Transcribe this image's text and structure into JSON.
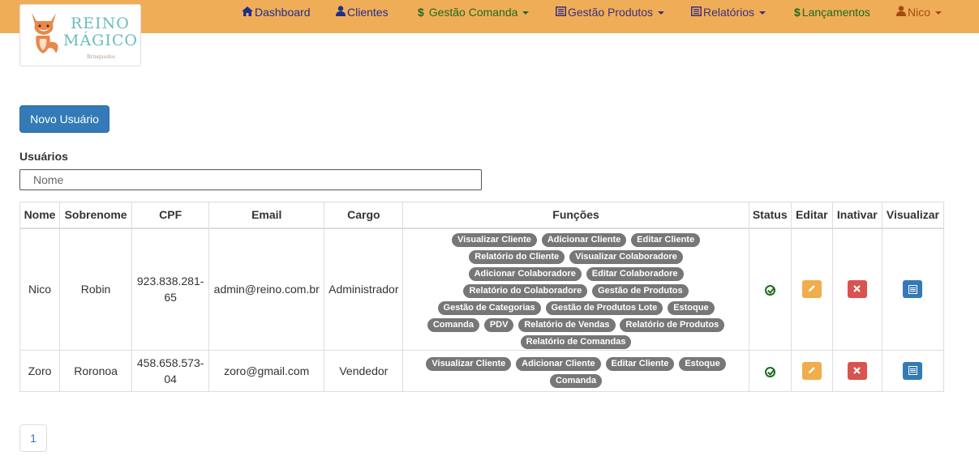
{
  "brand": {
    "line1": "REINO",
    "line2": "MÁGICO",
    "subtitle": "Brinquedos"
  },
  "nav": {
    "items": [
      {
        "label": "Dashboard",
        "icon": "home-icon",
        "dropdown": false
      },
      {
        "label": "Clientes",
        "icon": "user-icon",
        "dropdown": false
      },
      {
        "label": "Gestão Comanda",
        "icon": "dollar-icon",
        "dropdown": true
      },
      {
        "label": "Gestão Produtos",
        "icon": "list-alt-icon",
        "dropdown": true
      },
      {
        "label": "Relatórios",
        "icon": "list-alt-icon",
        "dropdown": true
      },
      {
        "label": "Lançamentos",
        "icon": "dollar-icon",
        "dropdown": false
      },
      {
        "label": "Nico",
        "icon": "user-icon",
        "dropdown": true
      }
    ]
  },
  "toolbar": {
    "new_user_label": "Novo Usuário"
  },
  "users_section": {
    "title": "Usuários",
    "search_placeholder": "Nome"
  },
  "table": {
    "headers": [
      "Nome",
      "Sobrenome",
      "CPF",
      "Email",
      "Cargo",
      "Funções",
      "Status",
      "Editar",
      "Inativar",
      "Visualizar"
    ],
    "rows": [
      {
        "nome": "Nico",
        "sobrenome": "Robin",
        "cpf": "923.838.281-65",
        "email": "admin@reino.com.br",
        "cargo": "Administrador",
        "funcoes": [
          "Visualizar Cliente",
          "Adicionar Cliente",
          "Editar Cliente",
          "Relatório do Cliente",
          "Visualizar Colaboradore",
          "Adicionar Colaboradore",
          "Editar Colaboradore",
          "Relatório do Colaboradore",
          "Gestão de Produtos",
          "Gestão de Categorias",
          "Gestão de Produtos Lote",
          "Estoque",
          "Comanda",
          "PDV",
          "Relatório de Vendas",
          "Relatório de Produtos",
          "Relatório de Comandas"
        ],
        "status": "active"
      },
      {
        "nome": "Zoro",
        "sobrenome": "Roronoa",
        "cpf": "458.658.573-04",
        "email": "zoro@gmail.com",
        "cargo": "Vendedor",
        "funcoes": [
          "Visualizar Cliente",
          "Adicionar Cliente",
          "Editar Cliente",
          "Estoque",
          "Comanda"
        ],
        "status": "active"
      }
    ]
  },
  "pagination": {
    "current_page": "1"
  },
  "colors": {
    "navbar": "#f0ad58",
    "primary": "#337ab7",
    "warning": "#f0ad4e",
    "danger": "#d9534f",
    "badge": "#777777",
    "status_ok": "#1b6e1b"
  }
}
